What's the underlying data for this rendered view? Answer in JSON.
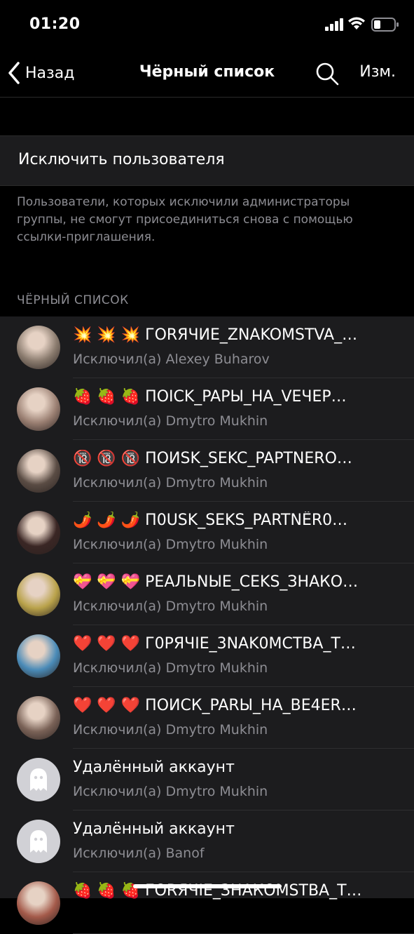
{
  "status_bar": {
    "time": "01:20"
  },
  "nav": {
    "back_label": "Назад",
    "title": "Чёрный список",
    "edit_label": "Изм."
  },
  "exclude_action": {
    "label": "Исключить пользователя"
  },
  "footer_text": "Пользователи, которых исключили администраторы группы, не смогут присоединиться снова с помощью ссылки-приглашения.",
  "section_header": "ЧЁРНЫЙ СПИСОК",
  "users": [
    {
      "title": "💥 💥 💥 ГОRЯЧИЕ_ZNAKOMSTVA_…",
      "subtitle": "Исключил(а) Alexey Buharov",
      "avatar": "photo",
      "color": "#8a7b6e"
    },
    {
      "title": "🍓 🍓 🍓 ПОICK_PAPЫ_HA_VEЧЕР…",
      "subtitle": "Исключил(а) Dmytro Mukhin",
      "avatar": "photo",
      "color": "#9a7f72"
    },
    {
      "title": "🔞 🔞 🔞 ПОИSK_SEKC_PAPTNERO…",
      "subtitle": "Исключил(а) Dmytro Mukhin",
      "avatar": "photo",
      "color": "#5a4c44"
    },
    {
      "title": "🌶️ 🌶️ 🌶️ П0USK_SEKS_PARTNЁR0…",
      "subtitle": "Исключил(а) Dmytro Mukhin",
      "avatar": "photo",
      "color": "#3a2624"
    },
    {
      "title": "💝 💝 💝 PEAЛЬNЫE_CEKS_ЗНАКО…",
      "subtitle": "Исключил(а) Dmytro Mukhin",
      "avatar": "photo",
      "color": "#b9a24a"
    },
    {
      "title": "❤️ ❤️ ❤️ Г0РЯЧIE_3NAK0MCTBA_T…",
      "subtitle": "Исключил(а) Dmytro Mukhin",
      "avatar": "photo",
      "color": "#4a8bb8"
    },
    {
      "title": "❤️ ❤️ ❤️ ПОИСК_PARЫ_HA_BE4ER…",
      "subtitle": "Исключил(а) Dmytro Mukhin",
      "avatar": "photo",
      "color": "#7a6257"
    },
    {
      "title": "Удалённый аккаунт",
      "subtitle": "Исключил(а) Dmytro Mukhin",
      "avatar": "ghost-icon",
      "color": "#d1d1d6"
    },
    {
      "title": "Удалённый аккаунт",
      "subtitle": "Исключил(а) Banof",
      "avatar": "ghost-icon",
      "color": "#d1d1d6"
    },
    {
      "title": "🍓 🍓 🍓 ГОRЯЧIE_ЗНАКОМSТВА_Т…",
      "subtitle": "",
      "avatar": "photo",
      "color": "#a45a4a"
    }
  ]
}
